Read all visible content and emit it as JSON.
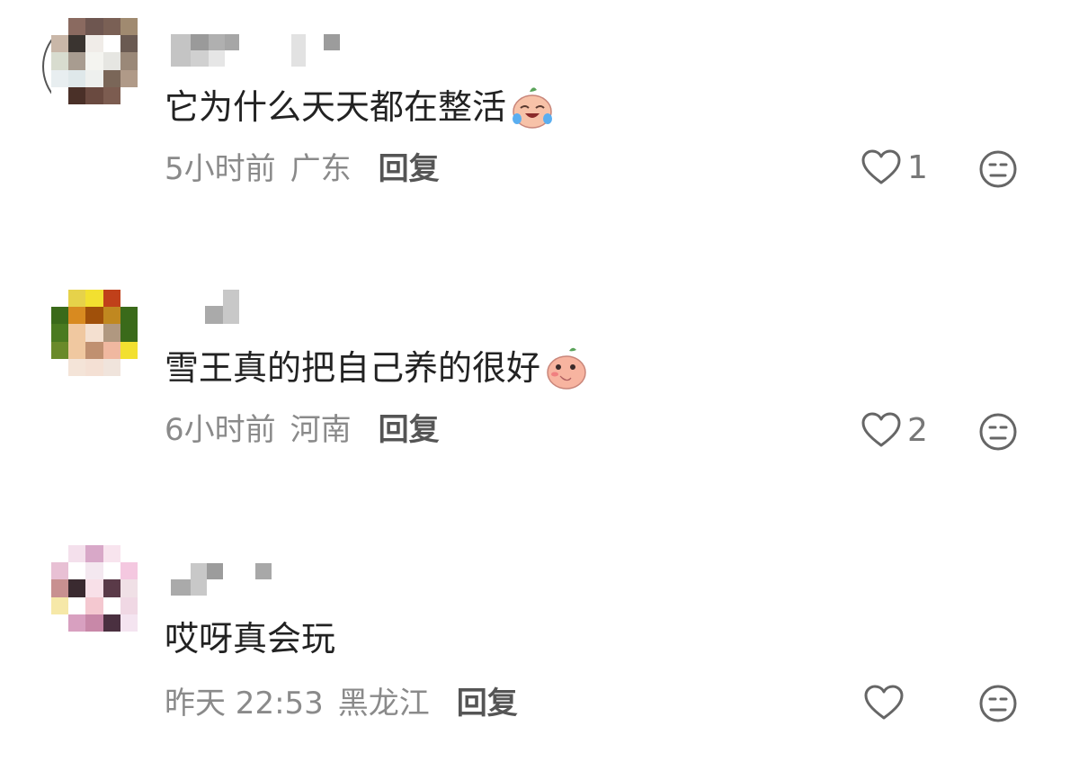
{
  "comments": [
    {
      "content": "它为什么天天都在整活",
      "time": "5小时前",
      "location": "广东",
      "reply_label": "回复",
      "likes": "1",
      "emoji_icon": "crying-laughing-peach-icon"
    },
    {
      "content": "雪王真的把自己养的很好",
      "time": "6小时前",
      "location": "河南",
      "reply_label": "回复",
      "likes": "2",
      "emoji_icon": "shy-peach-icon"
    },
    {
      "content": "哎呀真会玩",
      "time": "昨天 22:53",
      "location": "黑龙江",
      "reply_label": "回复",
      "likes": ""
    }
  ],
  "colors": {
    "text": "#222222",
    "meta": "#8a8a8a",
    "icon": "#666666"
  }
}
